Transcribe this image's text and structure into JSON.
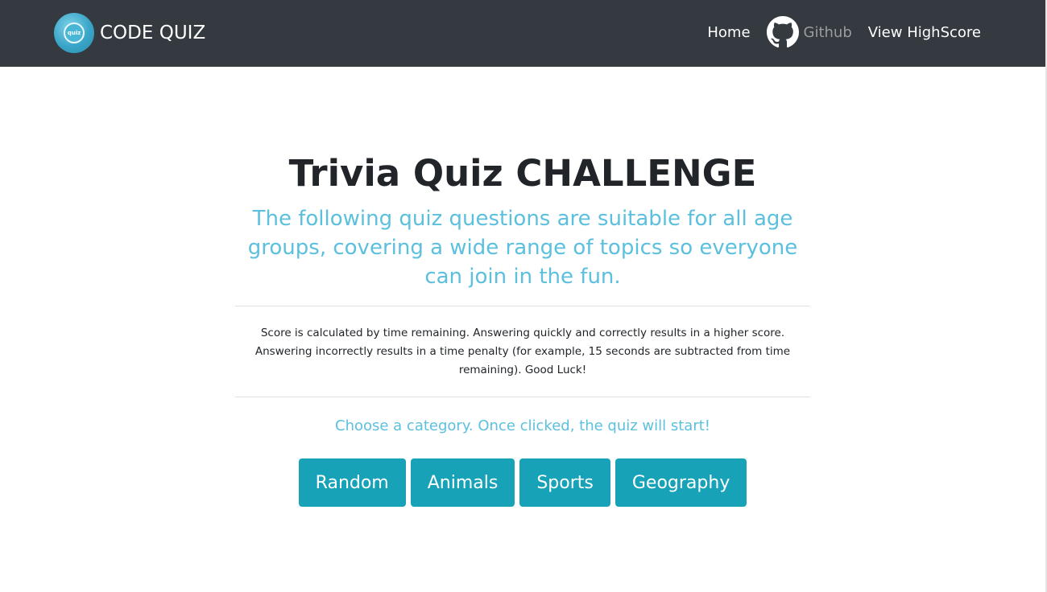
{
  "navbar": {
    "logo_text": "quiz",
    "brand": "CODE QUIZ",
    "links": {
      "home": "Home",
      "github": "Github",
      "highscore": "View HighScore"
    }
  },
  "main": {
    "title": "Trivia Quiz CHALLENGE",
    "lead": "The following quiz questions are suitable for all age groups, covering a wide range of topics so everyone can join in the fun.",
    "description": "Score is calculated by time remaining. Answering quickly and correctly results in a higher score. Answering incorrectly results in a time penalty (for example, 15 seconds are subtracted from time remaining). Good Luck!",
    "choose_text": "Choose a category. Once clicked, the quiz will start!",
    "categories": [
      "Random",
      "Animals",
      "Sports",
      "Geography"
    ]
  },
  "colors": {
    "navbar_bg": "#343a40",
    "accent_info": "#5bc0de",
    "button_bg": "#17a2b8"
  },
  "icons": {
    "logo": "quiz-logo-icon",
    "github": "github-icon"
  }
}
